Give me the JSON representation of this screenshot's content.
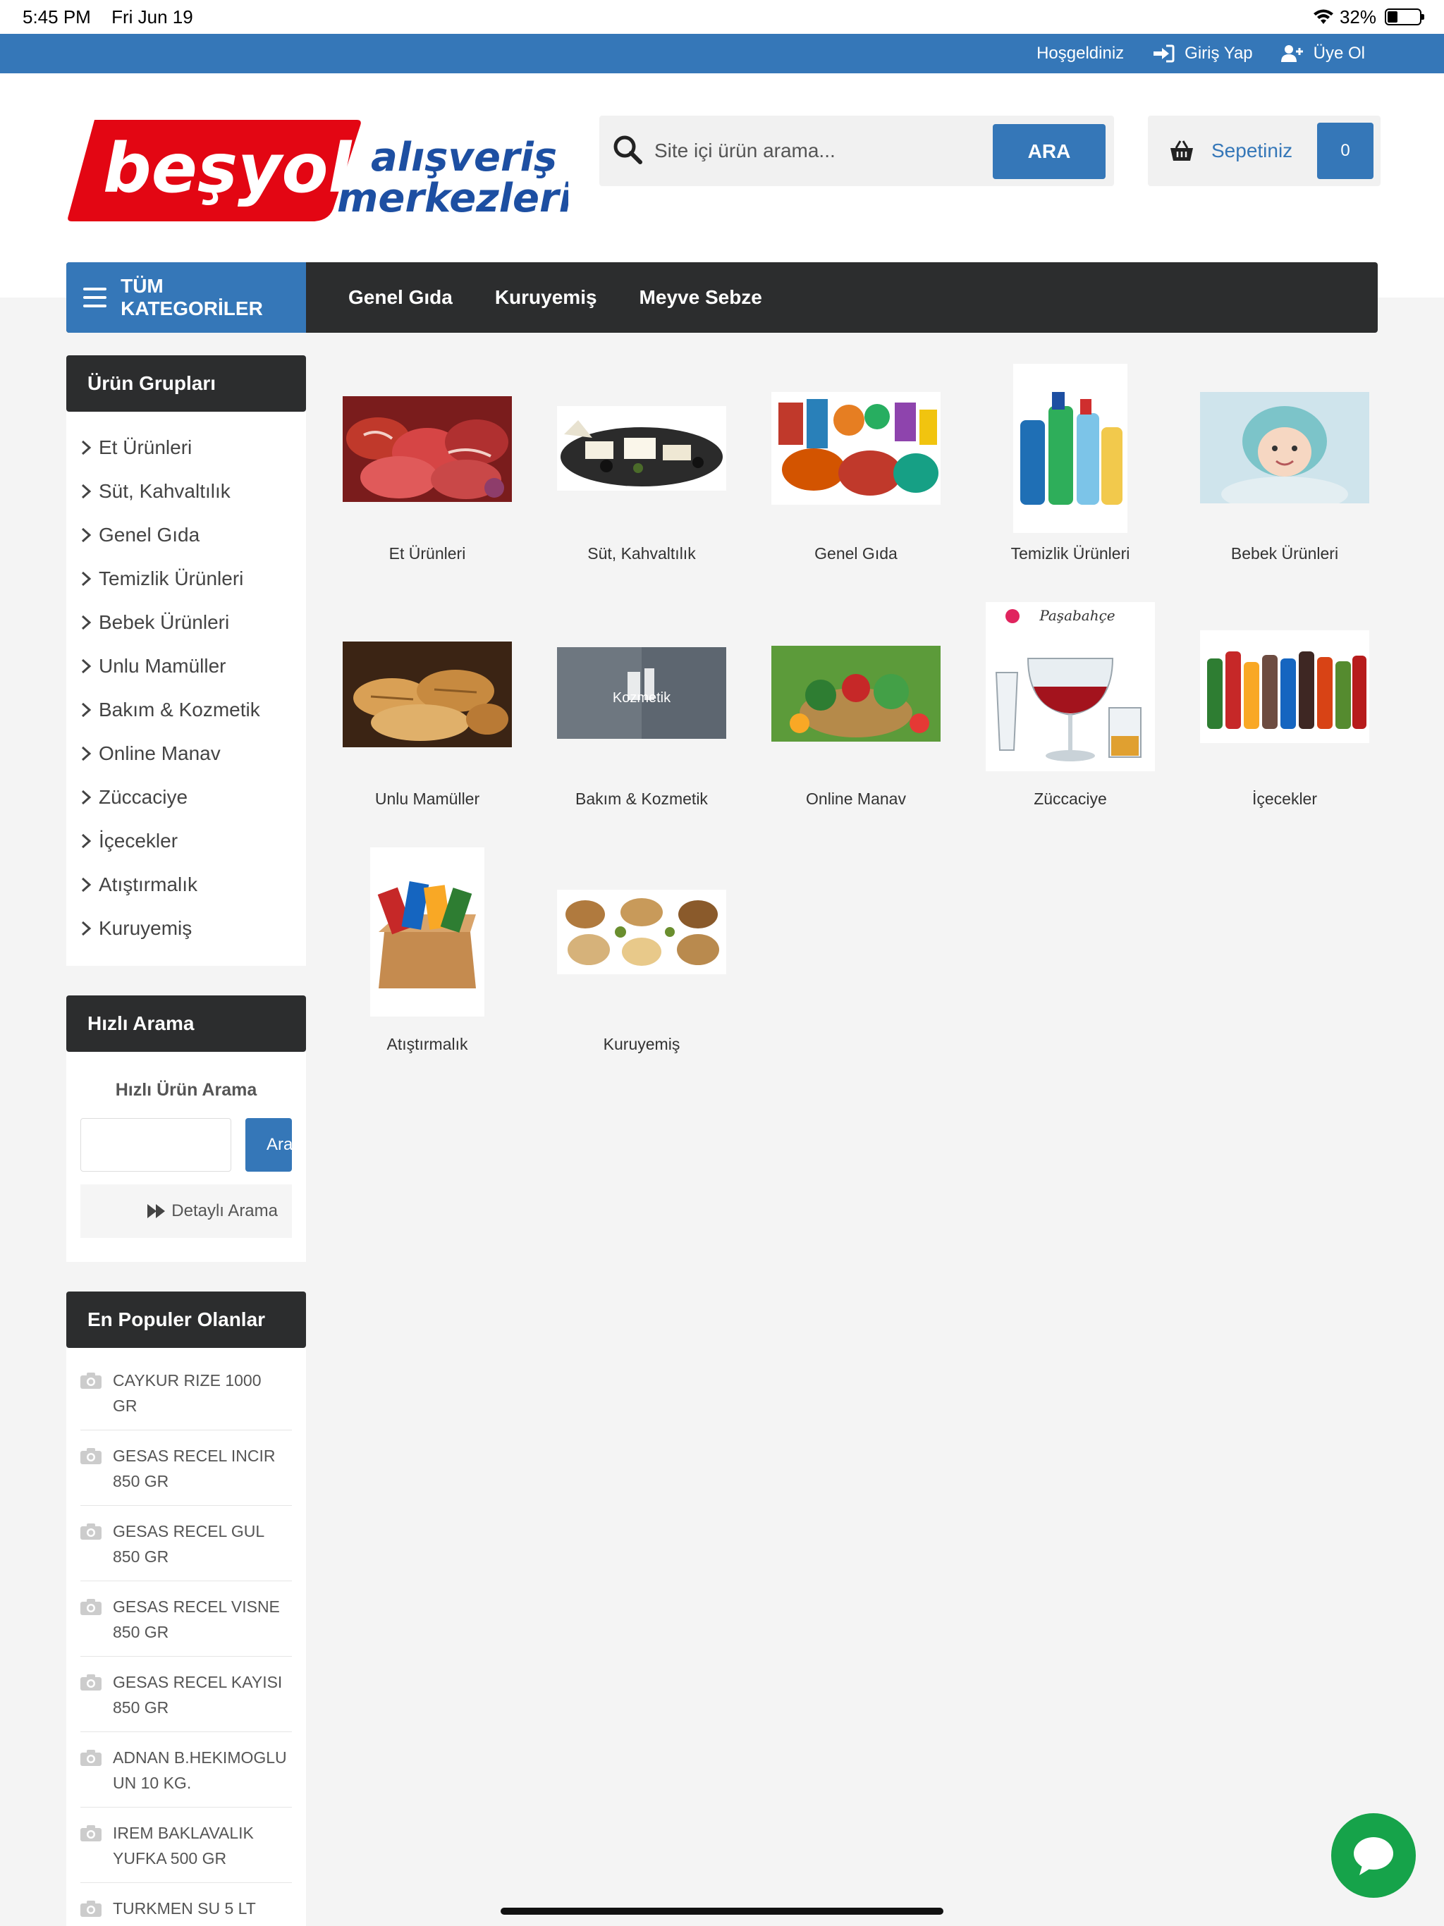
{
  "status_bar": {
    "time": "5:45 PM",
    "date": "Fri Jun 19",
    "battery": "32%",
    "battery_level": 0.32
  },
  "top_bar": {
    "welcome": "Hoşgeldiniz",
    "login": "Giriş Yap",
    "register": "Üye Ol"
  },
  "logo": {
    "brand": "beşyol",
    "line1": "alışveriş",
    "line2": "merkezleri",
    "brand_color": "#e30613",
    "text_color": "#1d4fa2"
  },
  "search": {
    "placeholder": "Site içi ürün arama...",
    "button": "ARA"
  },
  "cart": {
    "label": "Sepetiniz",
    "count": "0"
  },
  "nav": {
    "all_categories": "TÜM KATEGORİLER",
    "links": [
      "Genel Gıda",
      "Kuruyemiş",
      "Meyve Sebze"
    ]
  },
  "sidebar": {
    "groups_title": "Ürün Grupları",
    "categories": [
      "Et Ürünleri",
      "Süt, Kahvaltılık",
      "Genel Gıda",
      "Temizlik Ürünleri",
      "Bebek Ürünleri",
      "Unlu Mamüller",
      "Bakım & Kozmetik",
      "Online Manav",
      "Züccaciye",
      "İçecekler",
      "Atıştırmalık",
      "Kuruyemiş"
    ],
    "quick_title": "Hızlı Arama",
    "quick_subtitle": "Hızlı Ürün Arama",
    "quick_button": "Ara",
    "detail_search": "Detaylı Arama",
    "popular_title": "En Populer Olanlar",
    "popular": [
      "CAYKUR RIZE 1000 GR",
      "GESAS RECEL INCIR 850 GR",
      "GESAS RECEL GUL 850 GR",
      "GESAS RECEL VISNE 850 GR",
      "GESAS RECEL KAYISI 850 GR",
      "ADNAN B.HEKIMOGLU UN 10 KG.",
      "IREM BAKLAVALIK YUFKA 500 GR",
      "TURKMEN SU 5 LT"
    ]
  },
  "products": [
    {
      "label": "Et Ürünleri",
      "image": "meat-photo"
    },
    {
      "label": "Süt, Kahvaltılık",
      "image": "breakfast-photo"
    },
    {
      "label": "Genel Gıda",
      "image": "groceries-photo"
    },
    {
      "label": "Temizlik Ürünleri",
      "image": "cleaning-photo"
    },
    {
      "label": "Bebek Ürünleri",
      "image": "baby-photo"
    },
    {
      "label": "Unlu Mamüller",
      "image": "bread-photo"
    },
    {
      "label": "Bakım & Kozmetik",
      "image": "cosmetics-photo",
      "image_text": "Kozmetik"
    },
    {
      "label": "Online Manav",
      "image": "vegetables-photo"
    },
    {
      "label": "Züccaciye",
      "image": "glassware-photo",
      "image_text": "Paşabahçe"
    },
    {
      "label": "İçecekler",
      "image": "drinks-photo"
    },
    {
      "label": "Atıştırmalık",
      "image": "snacks-photo"
    },
    {
      "label": "Kuruyemiş",
      "image": "nuts-photo"
    }
  ],
  "colors": {
    "primary": "#3577b8",
    "dark": "#2c2d2e",
    "chat": "#16a34a"
  }
}
